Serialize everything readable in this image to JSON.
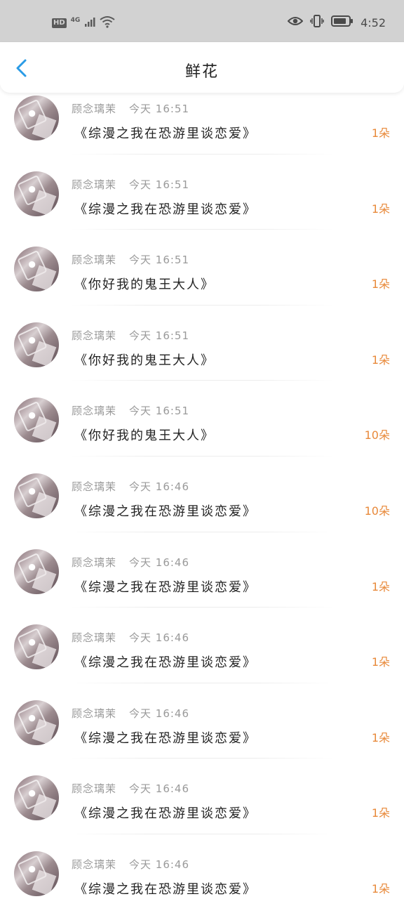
{
  "status_bar": {
    "hd": "HD",
    "network": "4G",
    "time": "4:52",
    "icons": [
      "signal-icon",
      "wifi-icon",
      "eye-icon",
      "vibrate-icon",
      "battery-icon"
    ]
  },
  "header": {
    "title": "鲜花",
    "back_icon": "chevron-left-icon",
    "accent_color": "#2a9be6"
  },
  "colors": {
    "amount": "#e8893a",
    "meta": "#9a9a9a",
    "text": "#222222"
  },
  "items": [
    {
      "user": "顾念璃茉",
      "time": "今天 16:51",
      "book": "《综漫之我在恐游里谈恋爱》",
      "amount": "1朵"
    },
    {
      "user": "顾念璃茉",
      "time": "今天 16:51",
      "book": "《综漫之我在恐游里谈恋爱》",
      "amount": "1朵"
    },
    {
      "user": "顾念璃茉",
      "time": "今天 16:51",
      "book": "《你好我的鬼王大人》",
      "amount": "1朵"
    },
    {
      "user": "顾念璃茉",
      "time": "今天 16:51",
      "book": "《你好我的鬼王大人》",
      "amount": "1朵"
    },
    {
      "user": "顾念璃茉",
      "time": "今天 16:51",
      "book": "《你好我的鬼王大人》",
      "amount": "10朵"
    },
    {
      "user": "顾念璃茉",
      "time": "今天 16:46",
      "book": "《综漫之我在恐游里谈恋爱》",
      "amount": "10朵"
    },
    {
      "user": "顾念璃茉",
      "time": "今天 16:46",
      "book": "《综漫之我在恐游里谈恋爱》",
      "amount": "1朵"
    },
    {
      "user": "顾念璃茉",
      "time": "今天 16:46",
      "book": "《综漫之我在恐游里谈恋爱》",
      "amount": "1朵"
    },
    {
      "user": "顾念璃茉",
      "time": "今天 16:46",
      "book": "《综漫之我在恐游里谈恋爱》",
      "amount": "1朵"
    },
    {
      "user": "顾念璃茉",
      "time": "今天 16:46",
      "book": "《综漫之我在恐游里谈恋爱》",
      "amount": "1朵"
    },
    {
      "user": "顾念璃茉",
      "time": "今天 16:46",
      "book": "《综漫之我在恐游里谈恋爱》",
      "amount": "1朵"
    }
  ]
}
